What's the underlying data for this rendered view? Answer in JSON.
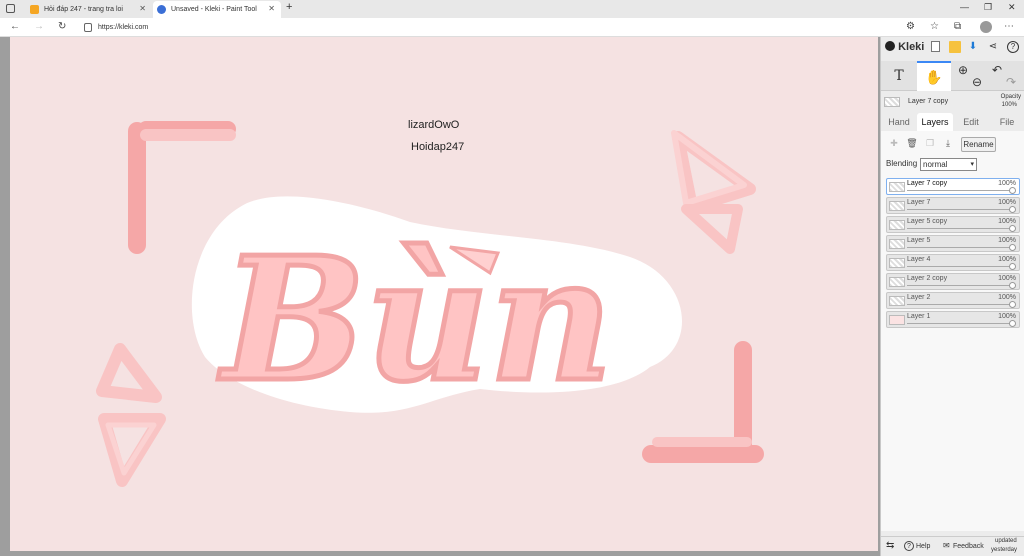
{
  "browser": {
    "tabs": [
      {
        "title": "Hỏi đáp 247 - trang tra loi",
        "favicon_color": "#f5a623"
      },
      {
        "title": "Unsaved - Kleki - Paint Tool",
        "favicon_color": "#3b6fd6"
      }
    ],
    "url": "https://kleki.com"
  },
  "canvas": {
    "text_lines": [
      "lizardOwO",
      "Hoidap247"
    ],
    "artwork_text": "Bùn",
    "colors": {
      "background": "#f5e2e2",
      "letter": "#ffc2c2",
      "shadow": "#f2a5a5",
      "outline": "#ffffff"
    }
  },
  "app": {
    "logo": "Kleki",
    "current_layer": "Layer 7 copy",
    "opacity_label": "Opacity",
    "opacity_value": "100%",
    "tabs": [
      "Hand",
      "Layers",
      "Edit",
      "File"
    ],
    "rename_label": "Rename",
    "blending_label": "Blending",
    "blending_value": "normal",
    "layers": [
      {
        "name": "Layer 7 copy",
        "opacity": "100%"
      },
      {
        "name": "Layer 7",
        "opacity": "100%"
      },
      {
        "name": "Layer 5 copy",
        "opacity": "100%"
      },
      {
        "name": "Layer 5",
        "opacity": "100%"
      },
      {
        "name": "Layer 4",
        "opacity": "100%"
      },
      {
        "name": "Layer 2 copy",
        "opacity": "100%"
      },
      {
        "name": "Layer 2",
        "opacity": "100%"
      },
      {
        "name": "Layer 1",
        "opacity": "100%"
      }
    ],
    "footer": {
      "help": "Help",
      "feedback": "Feedback",
      "updated": "updated",
      "updated_when": "yesterday"
    }
  }
}
